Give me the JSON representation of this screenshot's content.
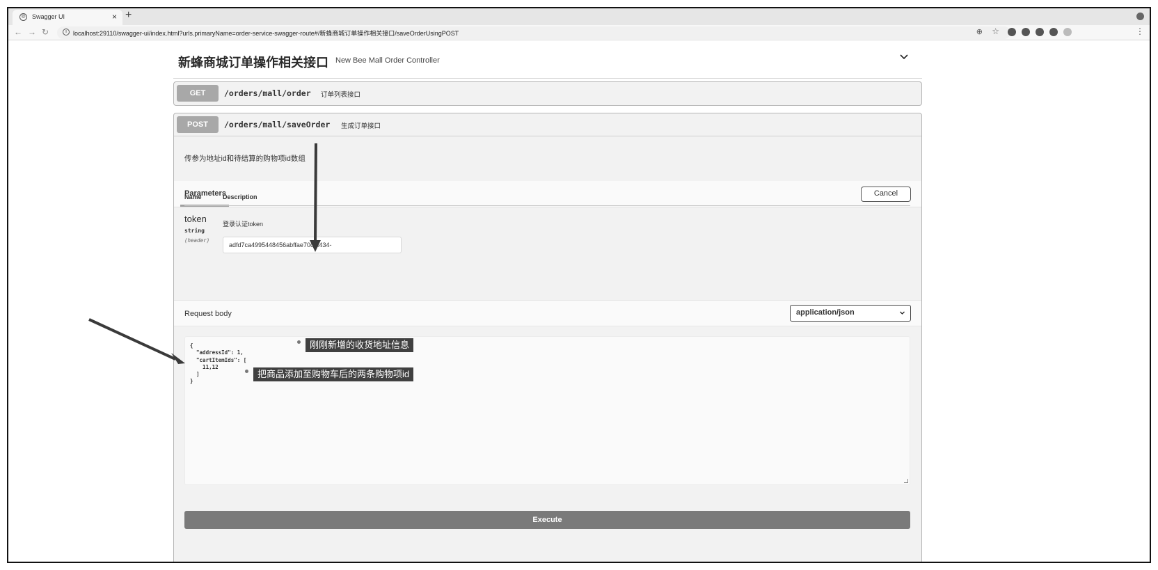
{
  "browser": {
    "tab_title": "Swagger UI",
    "tab_close": "×",
    "new_tab": "+",
    "url": "localhost:29110/swagger-ui/index.html?urls.primaryName=order-service-swagger-route#/新蜂商城订单操作相关接口/saveOrderUsingPOST"
  },
  "tag": {
    "title": "新蜂商城订单操作相关接口",
    "description": "New Bee Mall Order Controller"
  },
  "operations": [
    {
      "method": "GET",
      "path": "/orders/mall/order",
      "summary": "订单列表接口"
    },
    {
      "method": "POST",
      "path": "/orders/mall/saveOrder",
      "summary": "生成订单接口"
    }
  ],
  "expanded": {
    "description": "传参为地址id和待结算的购物项id数组",
    "parameters_tab": "Parameters",
    "cancel_label": "Cancel",
    "col_name": "Name",
    "col_description": "Description",
    "param": {
      "name": "token",
      "type": "string",
      "in": "(header)",
      "description": "登录认证token",
      "value": "adfd7ca4995448456abffae70d7f434-"
    },
    "request_body_label": "Request body",
    "content_type": "application/json",
    "body_lines": [
      "{",
      "  \"addressId\": 1,",
      "  \"cartItemIds\": [",
      "    11,12",
      "  ]",
      "}"
    ],
    "execute_label": "Execute"
  },
  "annotations": {
    "address_note": "刚刚新增的收货地址信息",
    "cart_note": "把商品添加至购物车后的两条购物项id"
  },
  "icons": [
    "globe-favicon",
    "back-arrow-icon",
    "forward-arrow-icon",
    "reload-icon",
    "info-icon",
    "zoom-icon",
    "star-icon",
    "extension-icon",
    "kebab-menu-icon",
    "chevron-down-icon",
    "caret-down-icon"
  ]
}
